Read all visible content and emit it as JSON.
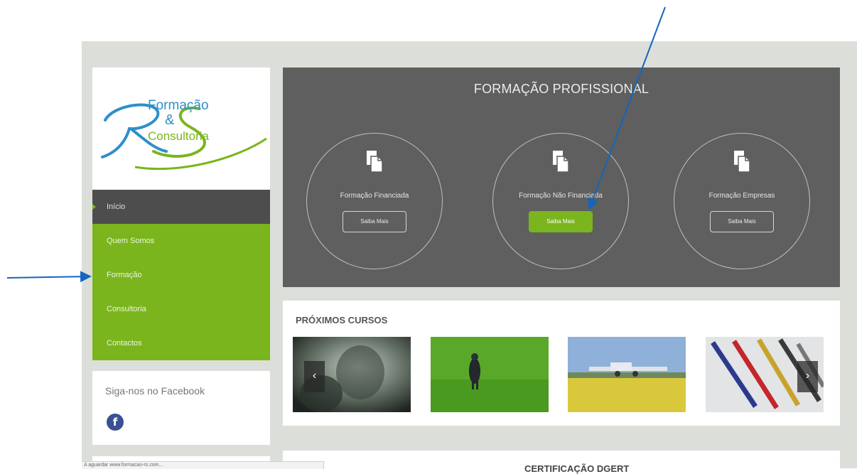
{
  "logo": {
    "top_text": "Formação",
    "amp": "&",
    "bottom_text": "Consultoria",
    "letters": "R S"
  },
  "nav": {
    "items": [
      {
        "label": "Início",
        "active": true
      },
      {
        "label": "Quem Somos"
      },
      {
        "label": "Formação"
      },
      {
        "label": "Consultoria"
      },
      {
        "label": "Contactos"
      }
    ]
  },
  "facebook": {
    "title": "Siga-nos no Facebook",
    "icon": "facebook-icon",
    "glyph": "f"
  },
  "hero": {
    "title": "FORMAÇÃO PROFISSIONAL",
    "cards": [
      {
        "label": "Formação Financiada",
        "button": "Saiba Mais"
      },
      {
        "label": "Formação Não Financiada",
        "button": "Saiba Mais"
      },
      {
        "label": "Formação Empresas",
        "button": "Saiba Mais"
      }
    ]
  },
  "courses": {
    "title": "PRÓXIMOS CURSOS",
    "prev": "‹",
    "next": "›"
  },
  "certification": {
    "title": "CERTIFICAÇÃO DGERT"
  },
  "status_bar": {
    "text": "A aguardar www.formacao-rs.com..."
  },
  "colors": {
    "brand_green": "#7ab51d",
    "hero_bg": "#5f5f5f",
    "annotation_arrow": "#1565c0"
  }
}
